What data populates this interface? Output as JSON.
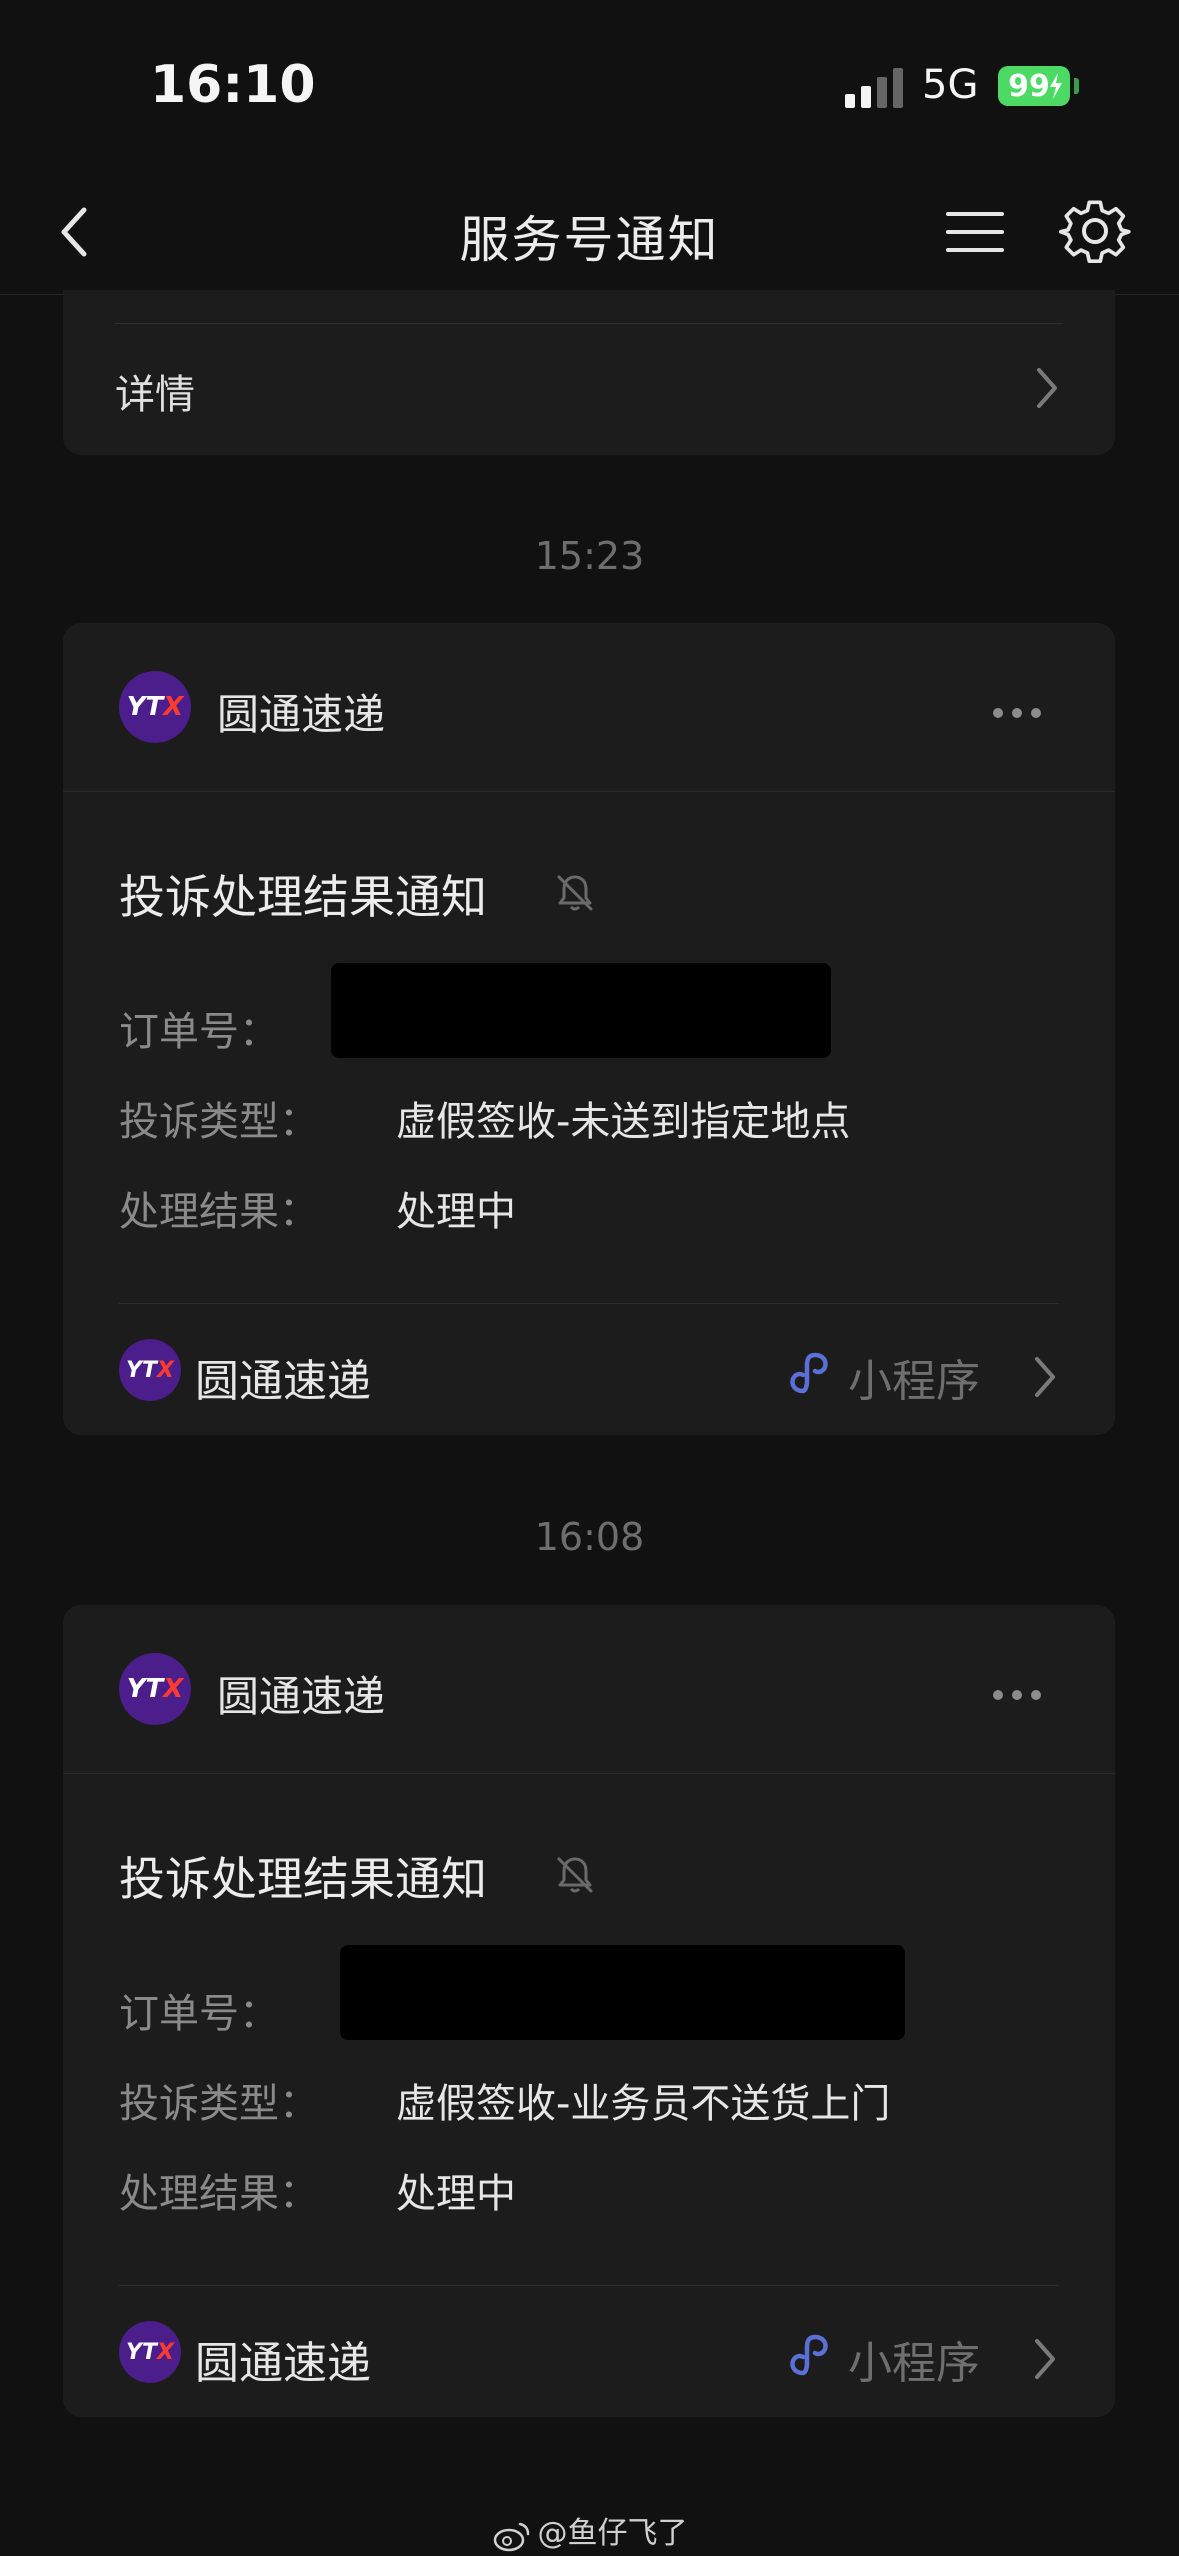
{
  "status_bar": {
    "time": "16:10",
    "network": "5G",
    "battery": "99"
  },
  "nav": {
    "title": "服务号通知",
    "icons": [
      "back-icon",
      "menu-icon",
      "gear-icon"
    ]
  },
  "top_card": {
    "detail_label": "详情"
  },
  "messages": [
    {
      "time": "15:23",
      "sender": "圆通速递",
      "title": "投诉处理结果通知",
      "rows": [
        {
          "label": "订单号：",
          "value": ""
        },
        {
          "label": "投诉类型：",
          "value": "虚假签收-未送到指定地点"
        },
        {
          "label": "处理结果：",
          "value": "处理中"
        }
      ],
      "footer": {
        "name": "圆通速递",
        "mini_program": "小程序"
      }
    },
    {
      "time": "16:08",
      "sender": "圆通速递",
      "title": "投诉处理结果通知",
      "rows": [
        {
          "label": "订单号：",
          "value": ""
        },
        {
          "label": "投诉类型：",
          "value": "虚假签收-业务员不送货上门"
        },
        {
          "label": "处理结果：",
          "value": "处理中"
        }
      ],
      "footer": {
        "name": "圆通速递",
        "mini_program": "小程序"
      }
    }
  ],
  "logo": {
    "text": "YT",
    "mark": "X"
  },
  "watermark": "@鱼仔飞了",
  "colors": {
    "background": "#111111",
    "card": "#1c1c1c",
    "logo_bg": "#4b1e8c",
    "logo_mark": "#ff3b30",
    "mini_program_icon": "#5b6fd6",
    "battery": "#4cd964"
  }
}
